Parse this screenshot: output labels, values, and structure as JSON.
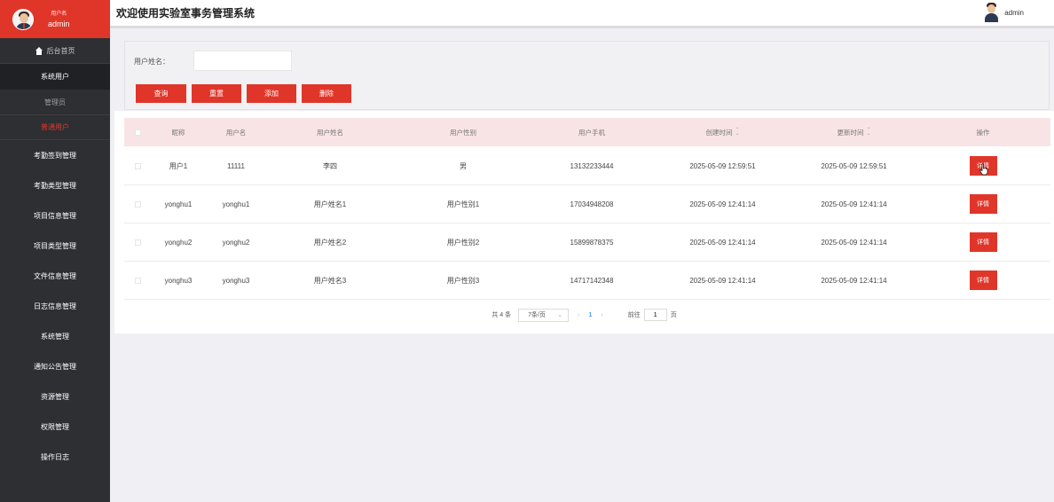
{
  "app": {
    "title": "欢迎使用实验室事务管理系统"
  },
  "sidebar": {
    "user_label": "用户名",
    "user_name": "admin",
    "home": "后台首页",
    "group": "系统用户",
    "sub_admin": "管理员",
    "sub_active": "普通用户",
    "items": [
      "考勤签到管理",
      "考勤类型管理",
      "项目信息管理",
      "项目类型管理",
      "文件信息管理",
      "日志信息管理",
      "系统管理",
      "通知公告管理",
      "资源管理",
      "权限管理",
      "操作日志"
    ]
  },
  "header": {
    "user_name": "admin"
  },
  "search": {
    "label": "用户姓名：",
    "value": "",
    "buttons": {
      "query": "查询",
      "reset": "重置",
      "add": "添加",
      "delete": "删除"
    }
  },
  "table": {
    "columns": [
      "昵称",
      "用户名",
      "用户姓名",
      "用户性别",
      "用户手机",
      "创建时间",
      "更新时间",
      "操作"
    ],
    "rows": [
      [
        "用户1",
        "11111",
        "李四",
        "男",
        "13132233444",
        "2025-05-09 12:59:51",
        "2025-05-09 12:59:51"
      ],
      [
        "yonghu1",
        "yonghu1",
        "用户姓名1",
        "用户性别1",
        "17034948208",
        "2025-05-09 12:41:14",
        "2025-05-09 12:41:14"
      ],
      [
        "yonghu2",
        "yonghu2",
        "用户姓名2",
        "用户性别2",
        "15899878375",
        "2025-05-09 12:41:14",
        "2025-05-09 12:41:14"
      ],
      [
        "yonghu3",
        "yonghu3",
        "用户姓名3",
        "用户性别3",
        "14717142348",
        "2025-05-09 12:41:14",
        "2025-05-09 12:41:14"
      ]
    ],
    "action_label": "详情"
  },
  "pagination": {
    "total": "共 4 条",
    "page_size": "7条/页",
    "current_page": "1",
    "goto_label": "前往",
    "goto_value": "1",
    "page_unit": "页"
  },
  "colors": {
    "accent": "#e0362a",
    "sidebar": "#2d2f33",
    "header_row": "#f8e4e4"
  }
}
